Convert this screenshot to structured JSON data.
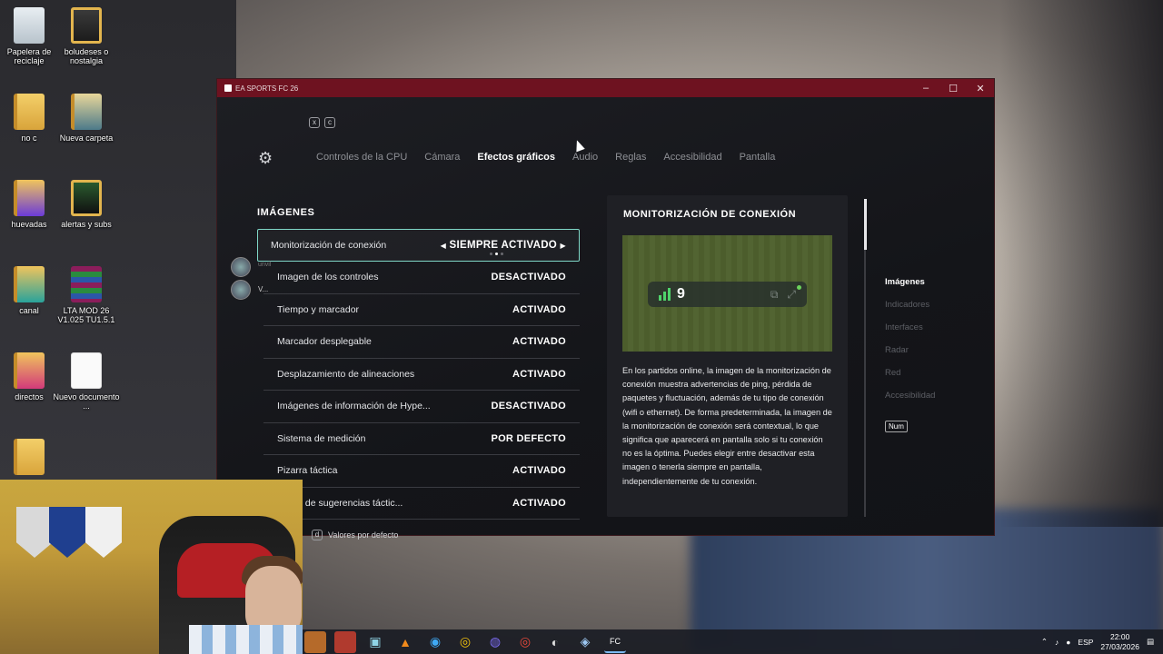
{
  "desktop": {
    "icons": [
      {
        "label": "Papelera de reciclaje"
      },
      {
        "label": "boludeses o nostalgia"
      },
      {
        "label": "no c"
      },
      {
        "label": "Nueva carpeta"
      },
      {
        "label": "huevadas"
      },
      {
        "label": "alertas y subs"
      },
      {
        "label": "canal"
      },
      {
        "label": "LTA MOD 26 V1.025 TU1.5.1"
      },
      {
        "label": "directos"
      },
      {
        "label": "Nuevo documento ..."
      }
    ]
  },
  "window": {
    "title": "EA SPORTS FC 26",
    "controls": {
      "minimize": "–",
      "maximize": "☐",
      "close": "✕"
    }
  },
  "game": {
    "key_hints": {
      "left": "x",
      "right": "c"
    },
    "tabs": [
      {
        "label": "Controles de la CPU",
        "active": false
      },
      {
        "label": "Cámara",
        "active": false
      },
      {
        "label": "Efectos gráficos",
        "active": true
      },
      {
        "label": "Audio",
        "active": false
      },
      {
        "label": "Reglas",
        "active": false
      },
      {
        "label": "Accesibilidad",
        "active": false
      },
      {
        "label": "Pantalla",
        "active": false
      }
    ],
    "section_title": "IMÁGENES",
    "settings": [
      {
        "label": "Monitorización de conexión",
        "value": "SIEMPRE ACTIVADO",
        "selected": true
      },
      {
        "label": "Imagen de los controles",
        "value": "DESACTIVADO"
      },
      {
        "label": "Tiempo y marcador",
        "value": "ACTIVADO"
      },
      {
        "label": "Marcador desplegable",
        "value": "ACTIVADO"
      },
      {
        "label": "Desplazamiento de alineaciones",
        "value": "ACTIVADO"
      },
      {
        "label": "Imágenes de información de Hype...",
        "value": "DESACTIVADO"
      },
      {
        "label": "Sistema de medición",
        "value": "POR DEFECTO"
      },
      {
        "label": "Pizarra táctica",
        "value": "ACTIVADO"
      },
      {
        "label": "...ción de sugerencias táctic...",
        "value": "ACTIVADO"
      }
    ],
    "selected_arrows": {
      "left": "◀",
      "right": "▶"
    },
    "reset": {
      "key": "d",
      "label": "Valores por defecto"
    },
    "info": {
      "title": "MONITORIZACIÓN DE CONEXIÓN",
      "hud_value": "9",
      "description": "En los partidos online, la imagen de la monitorización de conexión muestra advertencias de ping, pérdida de paquetes y fluctuación, además de tu tipo de conexión (wifi o ethernet). De forma predeterminada, la imagen de la monitorización de conexión será contextual, lo que significa que aparecerá en pantalla solo si tu conexión no es la óptima. Puedes elegir entre desactivar esta imagen o tenerla siempre en pantalla, independientemente de tu conexión."
    },
    "side_nav": [
      {
        "label": "Imágenes",
        "active": true
      },
      {
        "label": "Indicadores"
      },
      {
        "label": "Interfaces"
      },
      {
        "label": "Radar"
      },
      {
        "label": "Red"
      },
      {
        "label": "Accesibilidad"
      }
    ],
    "num_badge": "Num",
    "overlay_names": [
      "unvil",
      "V..."
    ]
  },
  "taskbar": {
    "tray": {
      "language": "ESP",
      "time": "22:00",
      "date": "27/03/2026"
    }
  },
  "colors": {
    "titlebar": "#6e1220",
    "selection_border": "#7fd7c7",
    "signal_green": "#4fd46b"
  }
}
